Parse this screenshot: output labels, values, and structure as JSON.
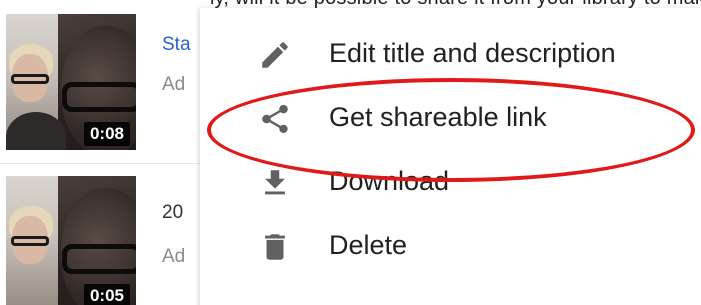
{
  "top_strip": {
    "text": "ly, will it be possible to share it from your library to make it public? "
  },
  "videos": [
    {
      "title": "Sta",
      "subtitle": "Ad",
      "duration": "0:08"
    },
    {
      "title": "20",
      "subtitle": "Ad",
      "duration": "0:05"
    }
  ],
  "context_menu": {
    "items": [
      {
        "label": "Edit title and description",
        "icon": "pencil-icon"
      },
      {
        "label": "Get shareable link",
        "icon": "share-icon"
      },
      {
        "label": "Download",
        "icon": "download-icon"
      },
      {
        "label": "Delete",
        "icon": "trash-icon"
      }
    ],
    "icon_color": "#616161"
  },
  "annotation": {
    "color": "#e01919",
    "target": "Get shareable link"
  },
  "colors": {
    "link_blue": "#2962c9",
    "muted_gray": "#8a8a8a",
    "text_dark": "#212121"
  }
}
